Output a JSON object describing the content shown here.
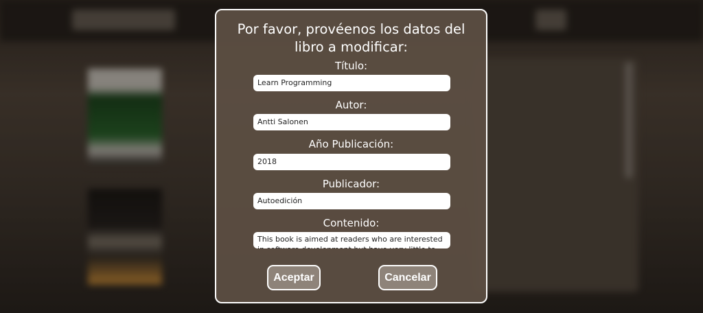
{
  "dialog": {
    "title": "Por favor, provéenos los datos del libro a modificar:",
    "fields": {
      "titulo": {
        "label": "Título:",
        "value": "Learn Programming"
      },
      "autor": {
        "label": "Autor:",
        "value": "Antti Salonen"
      },
      "anio": {
        "label": "Año Publicación:",
        "value": "2018"
      },
      "publicador": {
        "label": "Publicador:",
        "value": "Autoedición"
      },
      "contenido": {
        "label": "Contenido:",
        "value": "This book is aimed at readers who are interested in software development but have very little to"
      }
    },
    "accept_label": "Aceptar",
    "cancel_label": "Cancelar"
  }
}
